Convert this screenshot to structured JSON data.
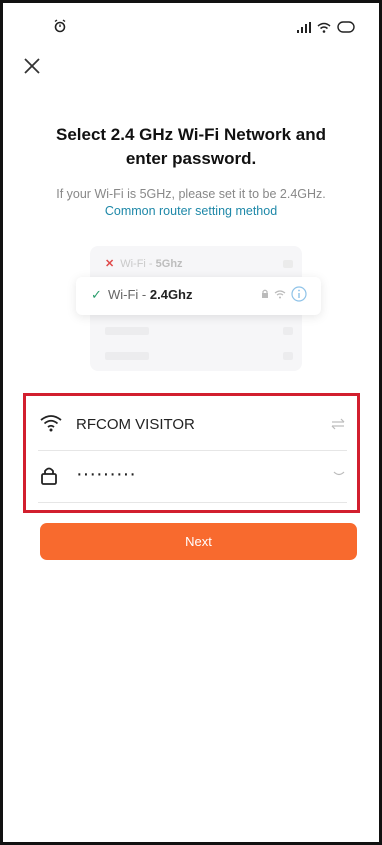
{
  "header": {
    "title_line1": "Select 2.4 GHz Wi-Fi Network and",
    "title_line2": "enter password.",
    "hint": "If your Wi-Fi is 5GHz, please set it to be 2.4GHz.",
    "link": "Common router setting method"
  },
  "illustration": {
    "row_5g_prefix": "Wi-Fi - ",
    "row_5g_band": "5Ghz",
    "row_24_prefix": "Wi-Fi - ",
    "row_24_band": "2.4Ghz",
    "row_5g_mark": "✕",
    "row_24_mark": "✓"
  },
  "form": {
    "ssid": "RFCOM VISITOR",
    "password_masked": "·········"
  },
  "next_label": "Next",
  "colors": {
    "accent": "#f86a2e",
    "highlight_border": "#d21f2e",
    "link": "#1e88a8"
  }
}
